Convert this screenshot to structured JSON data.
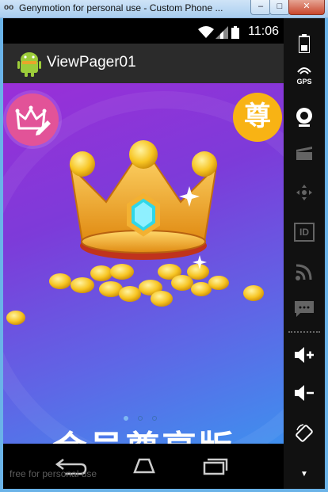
{
  "window": {
    "logo": "oo",
    "title": "Genymotion for personal use - Custom Phone ...",
    "minimize_label": "–",
    "maximize_label": "□",
    "close_label": "✕"
  },
  "status_bar": {
    "time": "11:06"
  },
  "action_bar": {
    "title": "ViewPager01"
  },
  "banner": {
    "vip_badge": "尊",
    "headline": "会员尊享版",
    "page_indicator": {
      "count": 3,
      "active_index": 0
    }
  },
  "watermark": "free for personal use",
  "side_panel": {
    "items": [
      {
        "name": "battery-icon",
        "label": ""
      },
      {
        "name": "gps-icon",
        "label": "GPS"
      },
      {
        "name": "webcam-icon",
        "label": ""
      },
      {
        "name": "media-icon",
        "label": ""
      },
      {
        "name": "dpad-icon",
        "label": ""
      },
      {
        "name": "identifier-icon",
        "label": "ID"
      },
      {
        "name": "network-icon",
        "label": ""
      },
      {
        "name": "sms-icon",
        "label": ""
      },
      {
        "name": "volume-up-icon",
        "label": ""
      },
      {
        "name": "volume-down-icon",
        "label": ""
      },
      {
        "name": "rotate-icon",
        "label": ""
      }
    ]
  },
  "colors": {
    "banner_top": "#9a2fd8",
    "banner_bottom": "#3f8fee",
    "crown_badge": "#e25398",
    "vip_badge": "#f8b314",
    "actionbar": "#2b2b2b"
  }
}
